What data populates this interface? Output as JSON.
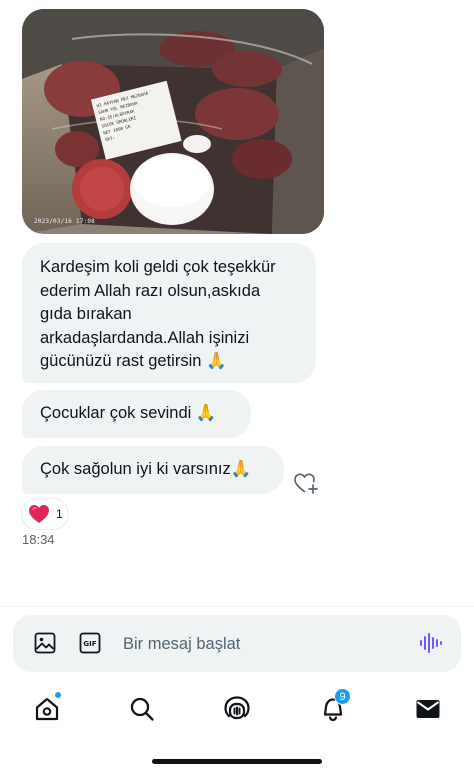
{
  "chat": {
    "photo": {
      "timestamp": "2023/03/16 17:08",
      "label_lines": [
        "HI HAYVAN MEZ MEZBAHA",
        "SAHR YOL MEZBAHA",
        "NO:35/ALBAYRAK",
        "SUCUK ÜRÜNLERİ",
        "NET 1000 GR",
        "SKT:"
      ]
    },
    "messages": [
      {
        "lines": [
          "Kardeşim koli geldi çok teşekkür",
          "ederim Allah razı olsun,askıda",
          "gıda bırakan",
          "arkadaşlardanda.Allah işinizi",
          "gücünüzü rast getirsin 🙏"
        ]
      },
      {
        "text": "Çocuklar çok sevindi 🙏"
      },
      {
        "text": "Çok sağolun iyi ki varsınız🙏"
      }
    ],
    "reaction": {
      "emoji": "heart-red",
      "count": "1"
    },
    "time": "18:34"
  },
  "composer": {
    "placeholder": "Bir mesaj başlat"
  },
  "tabbar": {
    "notifications_count": "9"
  },
  "colors": {
    "accent": "#1d9bf0",
    "bubble": "#eff3f4",
    "voice_icon": "#7856ff",
    "text": "#0f1419",
    "muted": "#536471"
  }
}
